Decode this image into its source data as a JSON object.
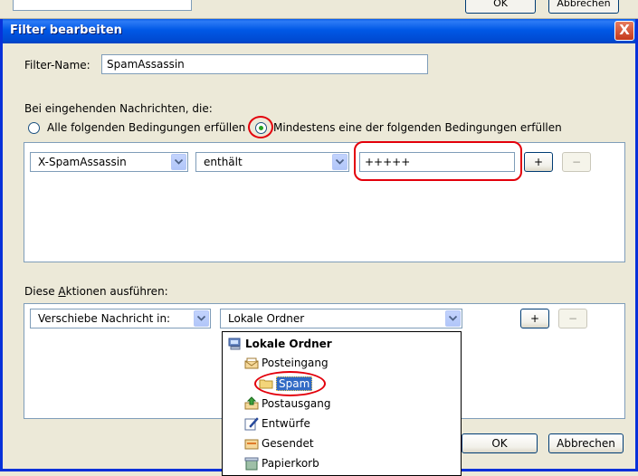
{
  "window": {
    "title": "Filter bearbeiten",
    "close_glyph": "X"
  },
  "background": {
    "ok_label": "OK",
    "cancel_label": "Abbrechen"
  },
  "filter_name": {
    "label": "Filter-Name:",
    "value": "SpamAssassin"
  },
  "incoming": {
    "heading": "Bei eingehenden Nachrichten, die:",
    "radio_all": "Alle folgenden Bedingungen erfüllen",
    "radio_any": "Mindestens eine der folgenden Bedingungen erfüllen",
    "selected": "any"
  },
  "condition": {
    "field": "X-SpamAssassin",
    "operator": "enthält",
    "value": "+++++",
    "add_label": "+",
    "remove_label": "−"
  },
  "actions": {
    "heading": "Diese Aktionen ausführen:",
    "action": "Verschiebe Nachricht in:",
    "target": "Lokale Ordner",
    "add_label": "+",
    "remove_label": "−"
  },
  "folder_tree": {
    "root": "Lokale Ordner",
    "items": [
      {
        "label": "Posteingang",
        "icon": "inbox-icon"
      },
      {
        "label": "Spam",
        "icon": "folder-icon",
        "selected": true
      },
      {
        "label": "Postausgang",
        "icon": "outbox-icon"
      },
      {
        "label": "Entwürfe",
        "icon": "drafts-icon"
      },
      {
        "label": "Gesendet",
        "icon": "sent-icon"
      },
      {
        "label": "Papierkorb",
        "icon": "trash-icon"
      }
    ]
  },
  "footer": {
    "ok_label": "OK",
    "cancel_label": "Abbrechen"
  },
  "colors": {
    "titlebar": "#0058e6",
    "highlight_ring": "#e3000b",
    "selection": "#316ac5"
  }
}
